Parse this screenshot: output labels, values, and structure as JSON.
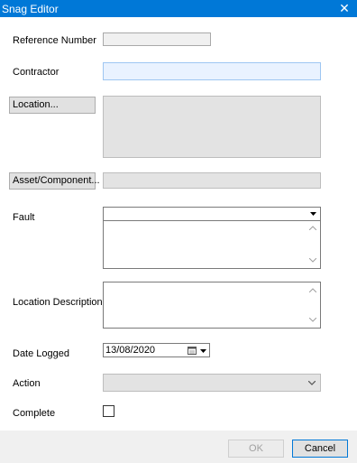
{
  "window": {
    "title": "Snag Editor",
    "close_glyph": "✕"
  },
  "form": {
    "reference_number": {
      "label": "Reference Number",
      "value": ""
    },
    "contractor": {
      "label": "Contractor",
      "value": ""
    },
    "location": {
      "button_label": "Location...",
      "value": ""
    },
    "asset_component": {
      "button_label": "Asset/Component...",
      "value": ""
    },
    "fault": {
      "label": "Fault",
      "selected": "",
      "details": ""
    },
    "location_description": {
      "label": "Location Description",
      "value": ""
    },
    "date_logged": {
      "label": "Date Logged",
      "value": "13/08/2020"
    },
    "action": {
      "label": "Action",
      "selected": ""
    },
    "complete": {
      "label": "Complete",
      "checked": false
    }
  },
  "footer": {
    "ok_label": "OK",
    "cancel_label": "Cancel"
  },
  "icons": {
    "fault_dropdown": "triangle-down-icon",
    "action_dropdown": "chevron-down-icon",
    "calendar": "calendar-icon"
  }
}
